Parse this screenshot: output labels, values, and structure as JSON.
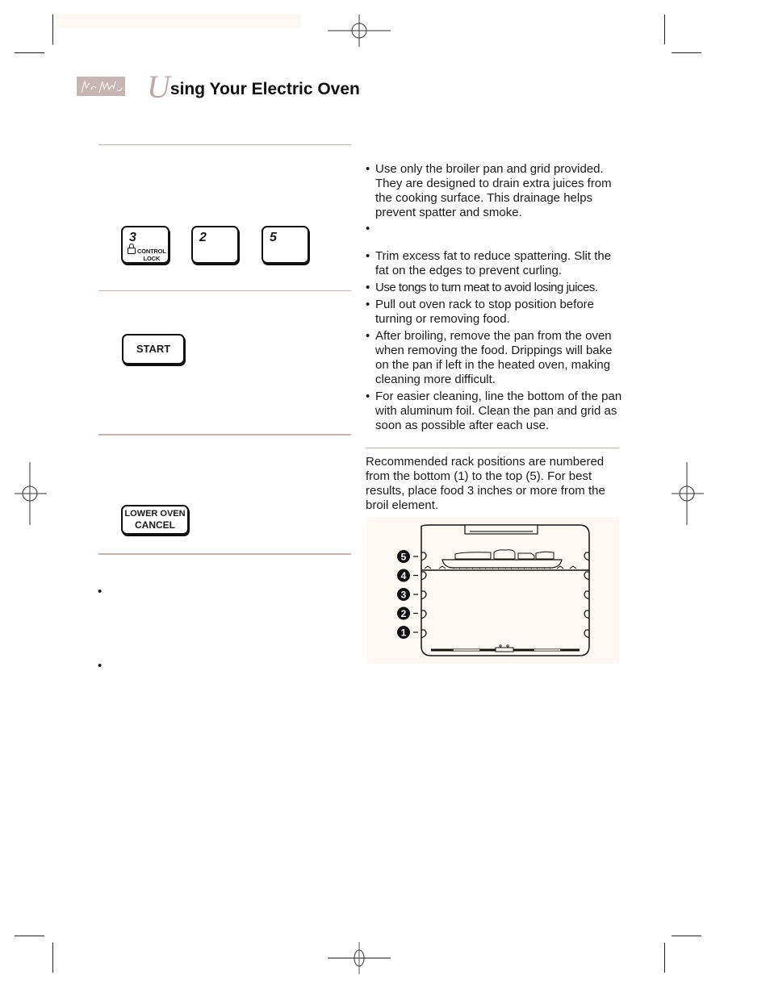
{
  "header": {
    "title_initial": "U",
    "title_rest": "sing Your Electric Oven",
    "signature_icon": "signature-logo"
  },
  "left_column": {
    "number_keys": [
      {
        "number": "3",
        "sublabel_line1": "CONTROL",
        "sublabel_line2": "LOCK",
        "icon": "lock-icon"
      },
      {
        "number": "2"
      },
      {
        "number": "5"
      }
    ],
    "start_key": "START",
    "cancel_key": {
      "line1": "LOWER OVEN",
      "line2": "CANCEL"
    },
    "bullets": [
      "•",
      "•"
    ]
  },
  "right_column": {
    "tips": [
      {
        "bullet": "•",
        "text": "Use only the broiler pan and grid provided. They are designed to drain extra juices from the cooking surface. This drainage helps prevent spatter and smoke."
      },
      {
        "bullet": "•",
        "text": ""
      },
      {
        "bullet": "•",
        "text": "Trim excess fat to reduce spattering. Slit the fat on the edges to prevent curling."
      },
      {
        "bullet": "•",
        "text": "Use tongs to turn meat to avoid losing juices."
      },
      {
        "bullet": "•",
        "text": "Pull out oven rack to stop position before turning or removing food."
      },
      {
        "bullet": "•",
        "text": "After broiling, remove the pan from the oven when removing the food. Drippings will bake on the pan if left in the heated oven, making cleaning more difficult."
      },
      {
        "bullet": "•",
        "text": "For easier cleaning, line the bottom of the pan with aluminum foil. Clean the pan and grid as soon as possible after each use."
      }
    ],
    "rack_paragraph": "Recommended rack positions are numbered from the bottom (1) to the top (5). For best results, place food 3 inches or more from the broil element.",
    "rack_labels": [
      "5",
      "4",
      "3",
      "2",
      "1"
    ]
  },
  "colors": {
    "accent_rule": "#c4b3ae",
    "title_initial": "#bda9a6",
    "panel_bg": "#fdf8f2"
  }
}
